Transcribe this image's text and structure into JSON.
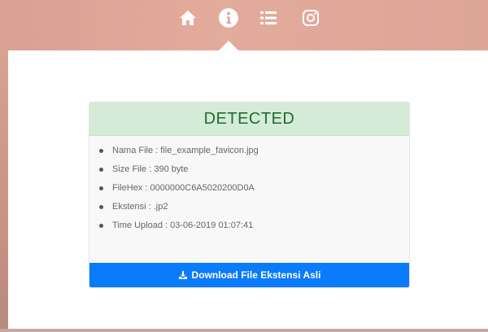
{
  "nav": {
    "icons": [
      "home-icon",
      "info-icon",
      "list-icon",
      "instagram-icon"
    ],
    "active": "info-icon",
    "icon_color": "#ffffff"
  },
  "result": {
    "status": "DETECTED",
    "status_color": "#1f6b31",
    "header_bg": "#d4ebd8",
    "items": [
      "Nama File : file_example_favicon.jpg",
      "Size File : 390 byte",
      "FileHex : 0000000C6A5020200D0A",
      "Ekstensi : .jp2",
      "Time Upload : 03-06-2019 01:07:41"
    ],
    "download_label": "Download File Ekstensi Asli",
    "download_icon": "download-icon",
    "button_color": "#0a7bfb"
  }
}
